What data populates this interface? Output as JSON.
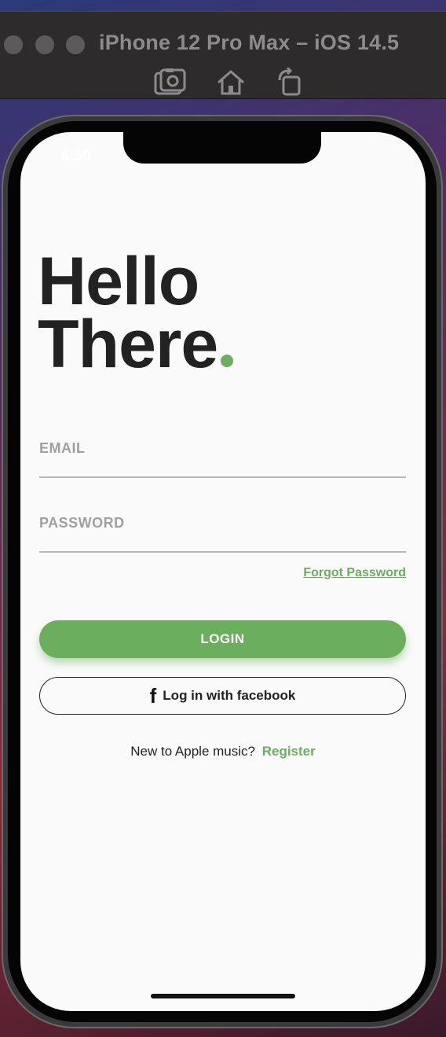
{
  "simulator": {
    "title": "iPhone 12 Pro Max – iOS 14.5",
    "tools": [
      "screenshot-icon",
      "home-icon",
      "rotate-icon"
    ]
  },
  "status_bar": {
    "time": "4:50"
  },
  "hero": {
    "line1": "Hello",
    "line2": "There"
  },
  "form": {
    "email_label": "EMAIL",
    "password_label": "PASSWORD",
    "forgot_label": "Forgot Password",
    "login_label": "LOGIN",
    "facebook_label": "Log in with facebook",
    "register_prompt": "New to Apple music?",
    "register_label": "Register"
  },
  "colors": {
    "accent": "#6aae5e",
    "text": "#222222",
    "muted": "#a0a0a0",
    "screen_bg": "#fafafa"
  }
}
